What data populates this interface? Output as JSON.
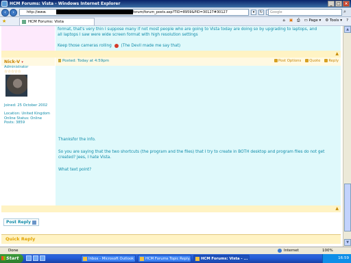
{
  "window": {
    "title": "HCM Forums: Vista - Windows Internet Explorer",
    "controls": [
      "_",
      "□",
      "×"
    ]
  },
  "address_bar": {
    "url_prefix": "http://www.",
    "url_suffix": "/forum/forum_posts.asp?TID=8959&PID=30127#30127",
    "search_placeholder": "Google"
  },
  "tab_bar": {
    "tab_title": "HCM Forums: Vista",
    "commands": {
      "page": "Page",
      "tools": "Tools"
    }
  },
  "previous_post": {
    "line1": "format, that's very thin I suppose many if not most people who are going to Vista today are doing so by upgrading to laptops, and",
    "line2": "all laptops I saw were wide screen format with high resolution settings",
    "line3_a": "Keep those cameras rolling",
    "line3_b": "(The Devil made me say that)"
  },
  "post": {
    "author": {
      "name": "Nick-V",
      "role": "Administrator",
      "stars": "☆☆☆☆☆",
      "joined": "Joined: 25 October 2002",
      "location": "Location: United Kingdom",
      "online_status": "Online Status: Online",
      "posts": "Posts: 3859"
    },
    "posted": "Posted: Today at 4:59pm",
    "actions": {
      "options": "Post Options",
      "quote": "Quote",
      "reply": "Reply"
    },
    "body": [
      "Thanksfor the info.",
      "So you are saying that the two shortcuts (the program and the files) that I try to create in BOTH desktop and program files do not get created? Jees, I hate Vista.",
      "What text point?"
    ]
  },
  "footer": {
    "post_reply": "Post Reply",
    "quick_reply": "Quick Reply"
  },
  "status_bar": {
    "status": "Done",
    "zone": "Internet",
    "zoom": "100%"
  },
  "taskbar": {
    "start": "Start",
    "tasks": [
      "Inbox - Microsoft Outlook",
      "HCM Forums Topic Reply...",
      "HCM Forums: Vista - ..."
    ],
    "clock": "16:59"
  }
}
